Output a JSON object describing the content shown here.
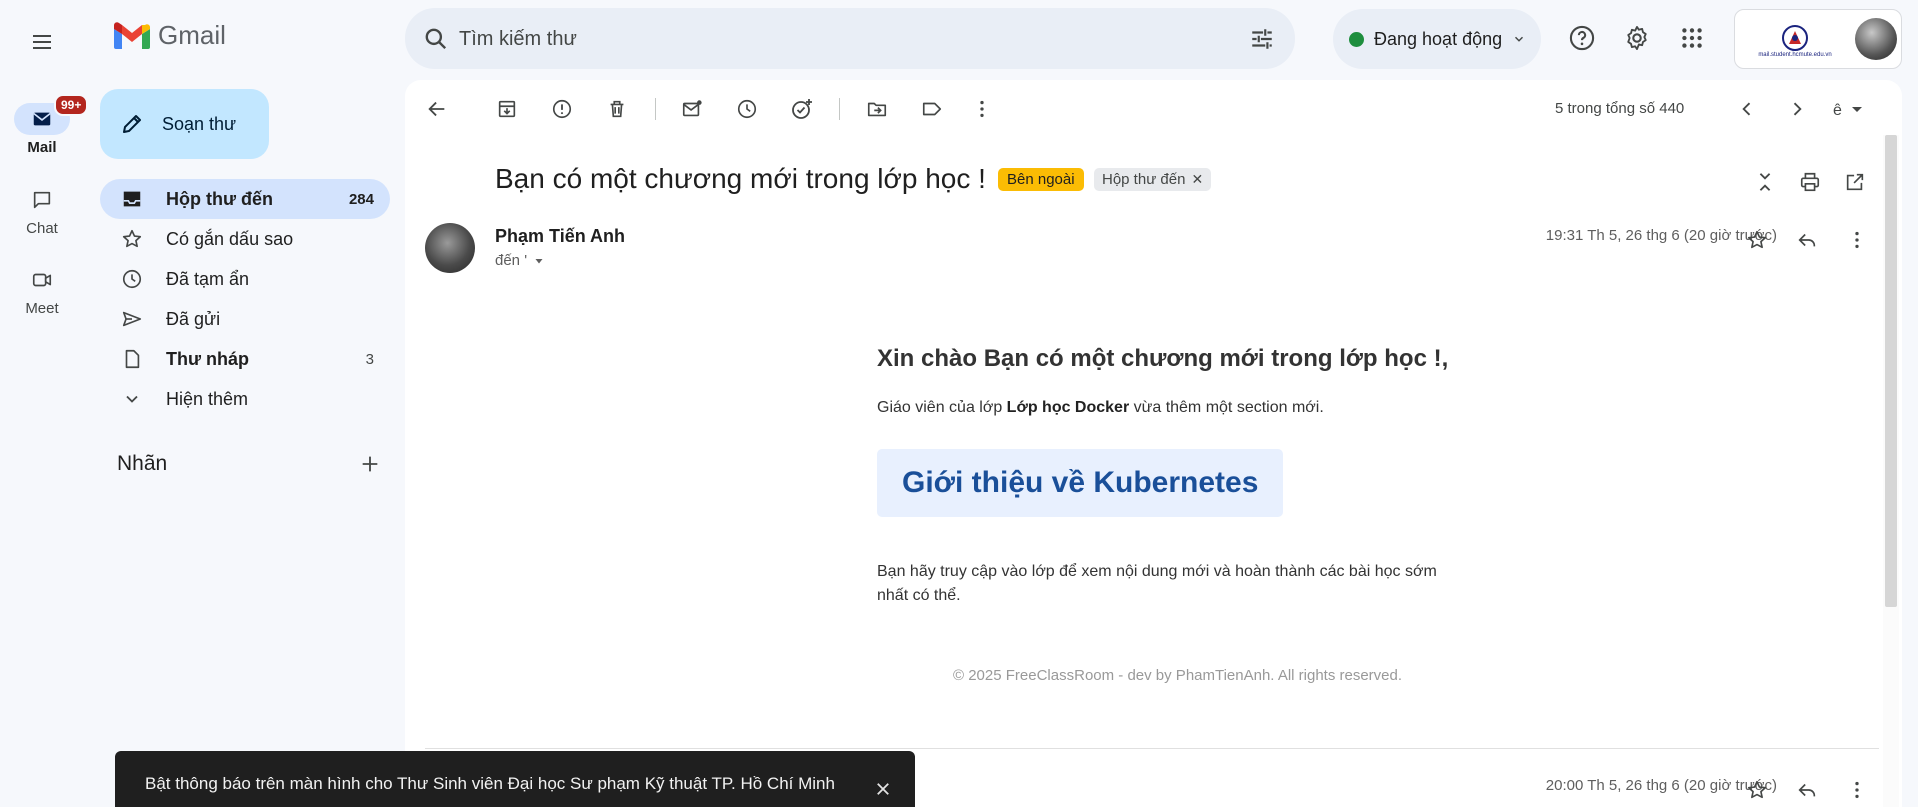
{
  "app": {
    "name": "Gmail"
  },
  "rail": {
    "items": [
      {
        "label": "Mail",
        "badge": "99+",
        "icon": "mail-icon"
      },
      {
        "label": "Chat",
        "icon": "chat-icon"
      },
      {
        "label": "Meet",
        "icon": "videocam-icon"
      }
    ]
  },
  "search": {
    "placeholder": "Tìm kiếm thư"
  },
  "status": {
    "label": "Đang hoạt động",
    "color": "#1e8e3e"
  },
  "account": {
    "org_logo_text": "mail.student.hcmute.edu.vn"
  },
  "compose": {
    "label": "Soạn thư"
  },
  "nav": {
    "items": [
      {
        "label": "Hộp thư đến",
        "count": "284",
        "icon": "inbox-icon"
      },
      {
        "label": "Có gắn dấu sao",
        "count": "",
        "icon": "star-icon"
      },
      {
        "label": "Đã tạm ẩn",
        "count": "",
        "icon": "clock-icon"
      },
      {
        "label": "Đã gửi",
        "count": "",
        "icon": "send-icon"
      },
      {
        "label": "Thư nháp",
        "count": "3",
        "icon": "draft-icon"
      },
      {
        "label": "Hiện thêm",
        "count": "",
        "icon": "chevron-down-icon"
      }
    ]
  },
  "labels": {
    "title": "Nhãn"
  },
  "toolbar": {
    "pager": "5 trong tổng số 440"
  },
  "email": {
    "subject": "Bạn có một chương mới trong lớp học !",
    "tag_external": "Bên ngoài",
    "tag_inbox": "Hộp thư đến",
    "sender": "Phạm Tiến Anh",
    "to": "đến '",
    "time": "19:31 Th 5, 26 thg 6 (20 giờ trước)",
    "greeting": "Xin chào Bạn có một chương mới trong lớp học !,",
    "intro_pre": "Giáo viên của lớp ",
    "intro_class": "Lớp học Docker",
    "intro_post": " vừa thêm một section mới.",
    "cta": "Giới thiệu về Kubernetes",
    "note": "Bạn hãy truy cập vào lớp để xem nội dung mới và hoàn thành các bài học sớm nhất có thể.",
    "footer": "© 2025 FreeClassRoom - dev by PhamTienAnh. All rights reserved."
  },
  "email2": {
    "time": "20:00 Th 5, 26 thg 6 (20 giờ trước)"
  },
  "toast": {
    "text": "Bật thông báo trên màn hình cho Thư Sinh viên Đại học Sư phạm Kỹ thuật TP. Hồ Chí Minh"
  }
}
